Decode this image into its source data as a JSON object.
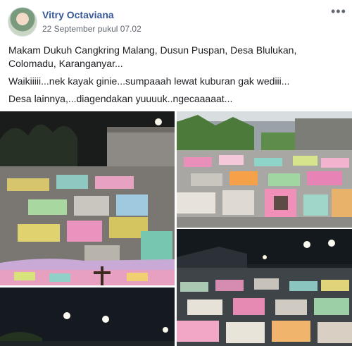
{
  "post": {
    "author": "Vitry Octaviana",
    "timestamp": "22 September pukul 07.02",
    "paragraphs": [
      "Makam Dukuh Cangkring Malang, Dusun Puspan, Desa Blulukan, Colomadu, Karanganyar...",
      "Waikiiiii...nek kayak ginie...sumpaaah lewat kuburan gak wediii...",
      "Desa lainnya,...diagendakan yuuuuk..ngecaaaaat..."
    ],
    "more_icon": "ellipsis-icon"
  },
  "photos": [
    {
      "name": "photo-cemetery-night-wall"
    },
    {
      "name": "photo-cemetery-day-colorful"
    },
    {
      "name": "photo-cemetery-night-lights"
    },
    {
      "name": "photo-cemetery-night-dark"
    }
  ]
}
